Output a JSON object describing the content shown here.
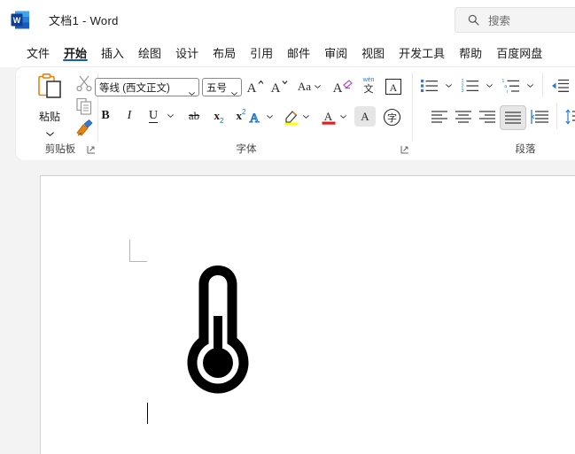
{
  "app": {
    "logo_name": "word-logo",
    "title": "文档1  -  Word",
    "accent": "#185abd",
    "logo_blue": "#185abd",
    "logo_dark": "#103f91"
  },
  "search": {
    "placeholder": "搜索",
    "icon": "search-icon"
  },
  "tabs": [
    {
      "label": "文件",
      "active": false
    },
    {
      "label": "开始",
      "active": true
    },
    {
      "label": "插入",
      "active": false
    },
    {
      "label": "绘图",
      "active": false
    },
    {
      "label": "设计",
      "active": false
    },
    {
      "label": "布局",
      "active": false
    },
    {
      "label": "引用",
      "active": false
    },
    {
      "label": "邮件",
      "active": false
    },
    {
      "label": "审阅",
      "active": false
    },
    {
      "label": "视图",
      "active": false
    },
    {
      "label": "开发工具",
      "active": false
    },
    {
      "label": "帮助",
      "active": false
    },
    {
      "label": "百度网盘",
      "active": false
    }
  ],
  "ribbon": {
    "groups": [
      {
        "name": "clipboard",
        "label": "剪贴板",
        "has_launcher": true
      },
      {
        "name": "font",
        "label": "字体",
        "has_launcher": true
      },
      {
        "name": "paragraph",
        "label": "段落",
        "has_launcher": false
      }
    ],
    "clipboard": {
      "paste_label": "粘贴",
      "paste_icon": "clipboard-icon",
      "cut_icon": "scissors-icon",
      "copy_icon": "copy-icon",
      "format_painter_icon": "format-painter-icon",
      "paste_accent": "#e8820c"
    },
    "font": {
      "font_name_value": "等线 (西文正文)",
      "font_size_value": "五号",
      "bold_label": "B",
      "italic_label": "I",
      "underline_label": "U",
      "strikethrough_label": "ab",
      "subscript_label": "x",
      "subscript_sub": "2",
      "superscript_label": "x",
      "superscript_sup": "2",
      "grow_font_label": "A",
      "shrink_font_label": "A",
      "change_case_label": "Aa",
      "clear_format_icon": "clear-formatting-icon",
      "phonetic_guide_label_top": "wén",
      "phonetic_guide_label_bottom": "文",
      "char_border_label": "A",
      "text_effects_label": "A",
      "highlight_label": "A",
      "highlight_color": "#ffff00",
      "font_color_label": "A",
      "font_color": "#e02020",
      "char_shading_label": "A",
      "enclose_char_label": "字",
      "text_effect_color": "#1976d2"
    },
    "paragraph": {
      "bullets_icon": "bulleted-list-icon",
      "numbering_icon": "numbered-list-icon",
      "multilevel_icon": "multilevel-list-icon",
      "decrease_indent_icon": "decrease-indent-icon",
      "increase_indent_icon": "increase-indent-icon",
      "align_left_icon": "align-left-icon",
      "align_center_icon": "align-center-icon",
      "align_right_icon": "align-right-icon",
      "justify_icon": "justify-icon",
      "distribute_icon": "distribute-icon",
      "line_spacing_icon": "line-spacing-icon",
      "selected": "justify",
      "accent": "#2b7cd3",
      "numbering_digits": [
        "1",
        "2",
        "3"
      ],
      "multilevel_marks": [
        "1",
        "a",
        "i"
      ]
    }
  },
  "document": {
    "content_glyph": "thermometer-icon",
    "caret_visible": true,
    "page_background": "#ffffff",
    "canvas_background": "#f3f3f3"
  }
}
